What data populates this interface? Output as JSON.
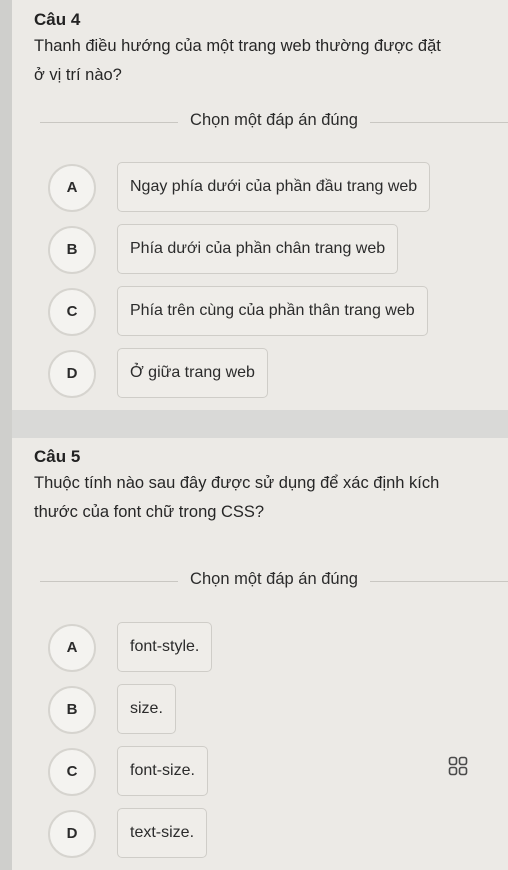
{
  "questions": [
    {
      "title": "Câu 4",
      "text_lines": [
        "Thanh điều hướng của một trang web thường được đặt",
        "ở vị trí nào?"
      ],
      "instruction": "Chọn một đáp án đúng",
      "options": [
        {
          "letter": "A",
          "text": "Ngay phía dưới của phần đầu trang web"
        },
        {
          "letter": "B",
          "text": "Phía dưới của phần chân trang web"
        },
        {
          "letter": "C",
          "text": "Phía trên cùng của phần thân trang web"
        },
        {
          "letter": "D",
          "text": "Ở giữa trang web"
        }
      ]
    },
    {
      "title": "Câu 5",
      "text_lines": [
        "Thuộc tính nào sau đây được sử dụng để xác định kích",
        "thước của font chữ trong CSS?"
      ],
      "instruction": "Chọn một đáp án đúng",
      "options": [
        {
          "letter": "A",
          "text": "font-style."
        },
        {
          "letter": "B",
          "text": "size."
        },
        {
          "letter": "C",
          "text": "font-size."
        },
        {
          "letter": "D",
          "text": "text-size."
        }
      ]
    }
  ],
  "icons": {
    "floating_menu": "grid-icon"
  }
}
